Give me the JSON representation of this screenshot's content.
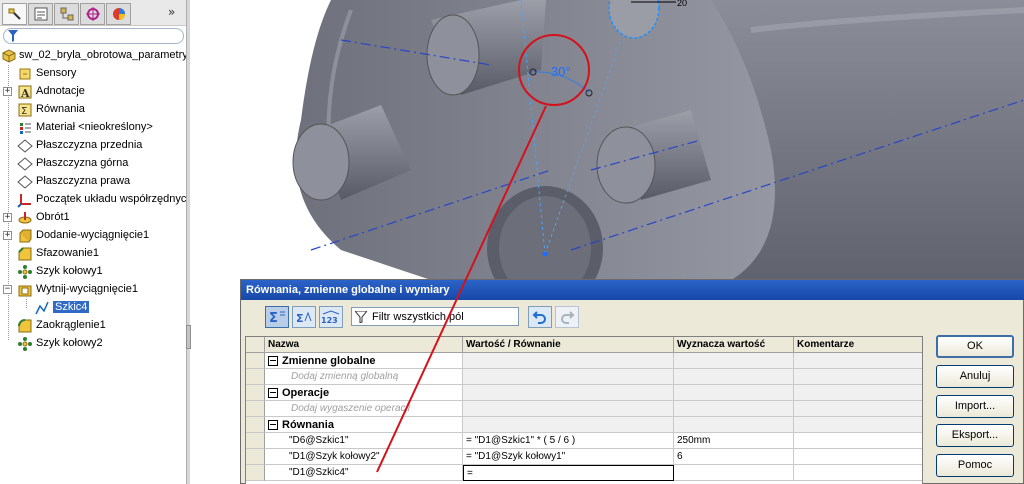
{
  "feature_tree": {
    "root_label": "sw_02_bryla_obrotowa_parametry",
    "items": [
      {
        "label": "Sensory",
        "icon": "sensor-icon",
        "expandable": false
      },
      {
        "label": "Adnotacje",
        "icon": "annotation-icon",
        "expandable": true
      },
      {
        "label": "Równania",
        "icon": "equations-icon",
        "expandable": false
      },
      {
        "label": "Materiał <nieokreślony>",
        "icon": "material-icon",
        "expandable": false
      },
      {
        "label": "Płaszczyzna przednia",
        "icon": "plane-icon",
        "expandable": false
      },
      {
        "label": "Płaszczyzna górna",
        "icon": "plane-icon",
        "expandable": false
      },
      {
        "label": "Płaszczyzna prawa",
        "icon": "plane-icon",
        "expandable": false
      },
      {
        "label": "Początek układu współrzędnych",
        "icon": "origin-icon",
        "expandable": false
      },
      {
        "label": "Obrót1",
        "icon": "revolve-icon",
        "expandable": true
      },
      {
        "label": "Dodanie-wyciągnięcie1",
        "icon": "extrude-icon",
        "expandable": true
      },
      {
        "label": "Sfazowanie1",
        "icon": "chamfer-icon",
        "expandable": false
      },
      {
        "label": "Szyk kołowy1",
        "icon": "circular-pattern-icon",
        "expandable": false
      },
      {
        "label": "Wytnij-wyciągnięcie1",
        "icon": "cut-extrude-icon",
        "expandable": true
      },
      {
        "label": "Szkic4",
        "icon": "sketch-icon",
        "expandable": false,
        "selected": true
      },
      {
        "label": "Zaokrąglenie1",
        "icon": "fillet-icon",
        "expandable": false
      },
      {
        "label": "Szyk kołowy2",
        "icon": "circular-pattern-icon",
        "expandable": false
      }
    ],
    "expand_symbol": "»"
  },
  "viewport": {
    "angle_dimension": "30°",
    "top_dimension_fragment": "20"
  },
  "dialog": {
    "title": "Równania, zmienne globalne i wymiary",
    "filter_placeholder": "Filtr wszystkich pól",
    "columns": [
      "Nazwa",
      "Wartość / Równanie",
      "Wyznacza wartość",
      "Komentarze"
    ],
    "groups": {
      "globals": {
        "label": "Zmienne globalne",
        "placeholder": "Dodaj zmienną globalną"
      },
      "features": {
        "label": "Operacje",
        "placeholder": "Dodaj wygaszenie operacji"
      },
      "equations": {
        "label": "Równania"
      }
    },
    "equations": [
      {
        "name": "\"D6@Szkic1\"",
        "value": "= \"D1@Szkic1\" * ( 5 / 6 )",
        "evaluates": "250mm",
        "comment": ""
      },
      {
        "name": "\"D1@Szyk kołowy2\"",
        "value": "= \"D1@Szyk kołowy1\"",
        "evaluates": "6",
        "comment": ""
      },
      {
        "name": "\"D1@Szkic4\"",
        "value": "=",
        "evaluates": "",
        "comment": ""
      }
    ],
    "buttons": {
      "ok": "OK",
      "cancel": "Anuluj",
      "import": "Import...",
      "export": "Eksport...",
      "help": "Pomoc"
    }
  },
  "colors": {
    "title_bar": "#1f55b8",
    "part_body": "#7d7f8b",
    "annotation_red": "#d4121b",
    "selection_blue": "#316ac5"
  }
}
